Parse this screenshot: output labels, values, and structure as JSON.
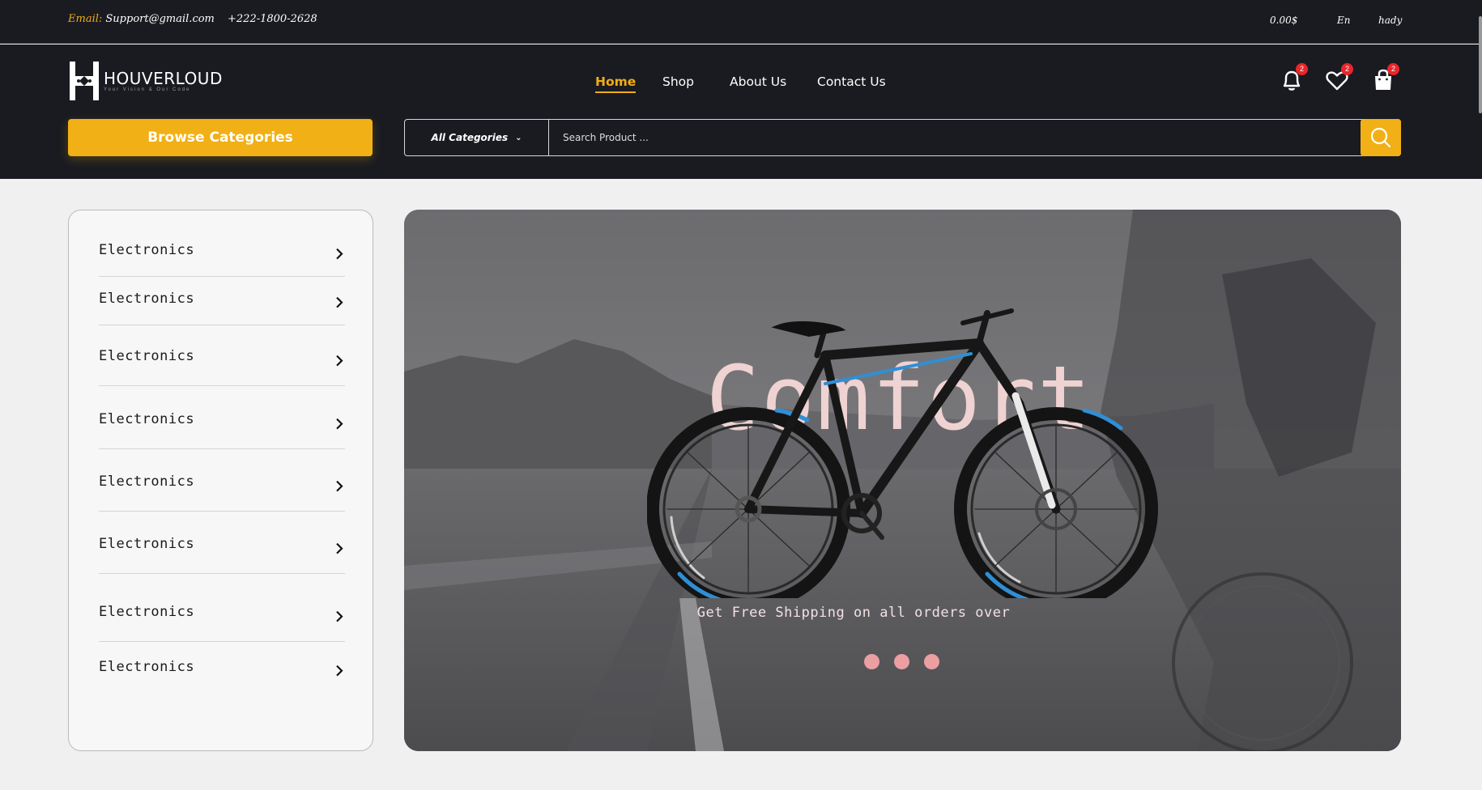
{
  "topbar": {
    "email_label": "Email:",
    "email": "Support@gmail.com",
    "phone": "+222-1800-2628",
    "balance": "0.00$",
    "language": "En",
    "user": "hady"
  },
  "brand": {
    "name": "HOUVERLOUD",
    "tagline": "Your Vision & Our Code"
  },
  "nav": {
    "items": [
      {
        "label": "Home",
        "active": true
      },
      {
        "label": "Shop"
      },
      {
        "label": "About Us"
      },
      {
        "label": "Contact Us"
      }
    ]
  },
  "header_icons": {
    "notifications_count": "2",
    "wishlist_count": "2",
    "cart_count": "2"
  },
  "browse_button": "Browse Categories",
  "search": {
    "category": "All Categories",
    "placeholder": "Search Product ..."
  },
  "sidebar": {
    "categories": [
      "Electronics",
      "Electronics",
      "Electronics",
      "Electronics",
      "Electronics",
      "Electronics",
      "Electronics",
      "Electronics"
    ]
  },
  "hero": {
    "headline": "Comfort",
    "subtitle": "Get Free Shipping on all orders over",
    "slides": 3
  },
  "colors": {
    "accent": "#f1b015",
    "header_bg": "#1a1b21",
    "badge": "#e8262b",
    "dot": "#ec9fa1"
  }
}
